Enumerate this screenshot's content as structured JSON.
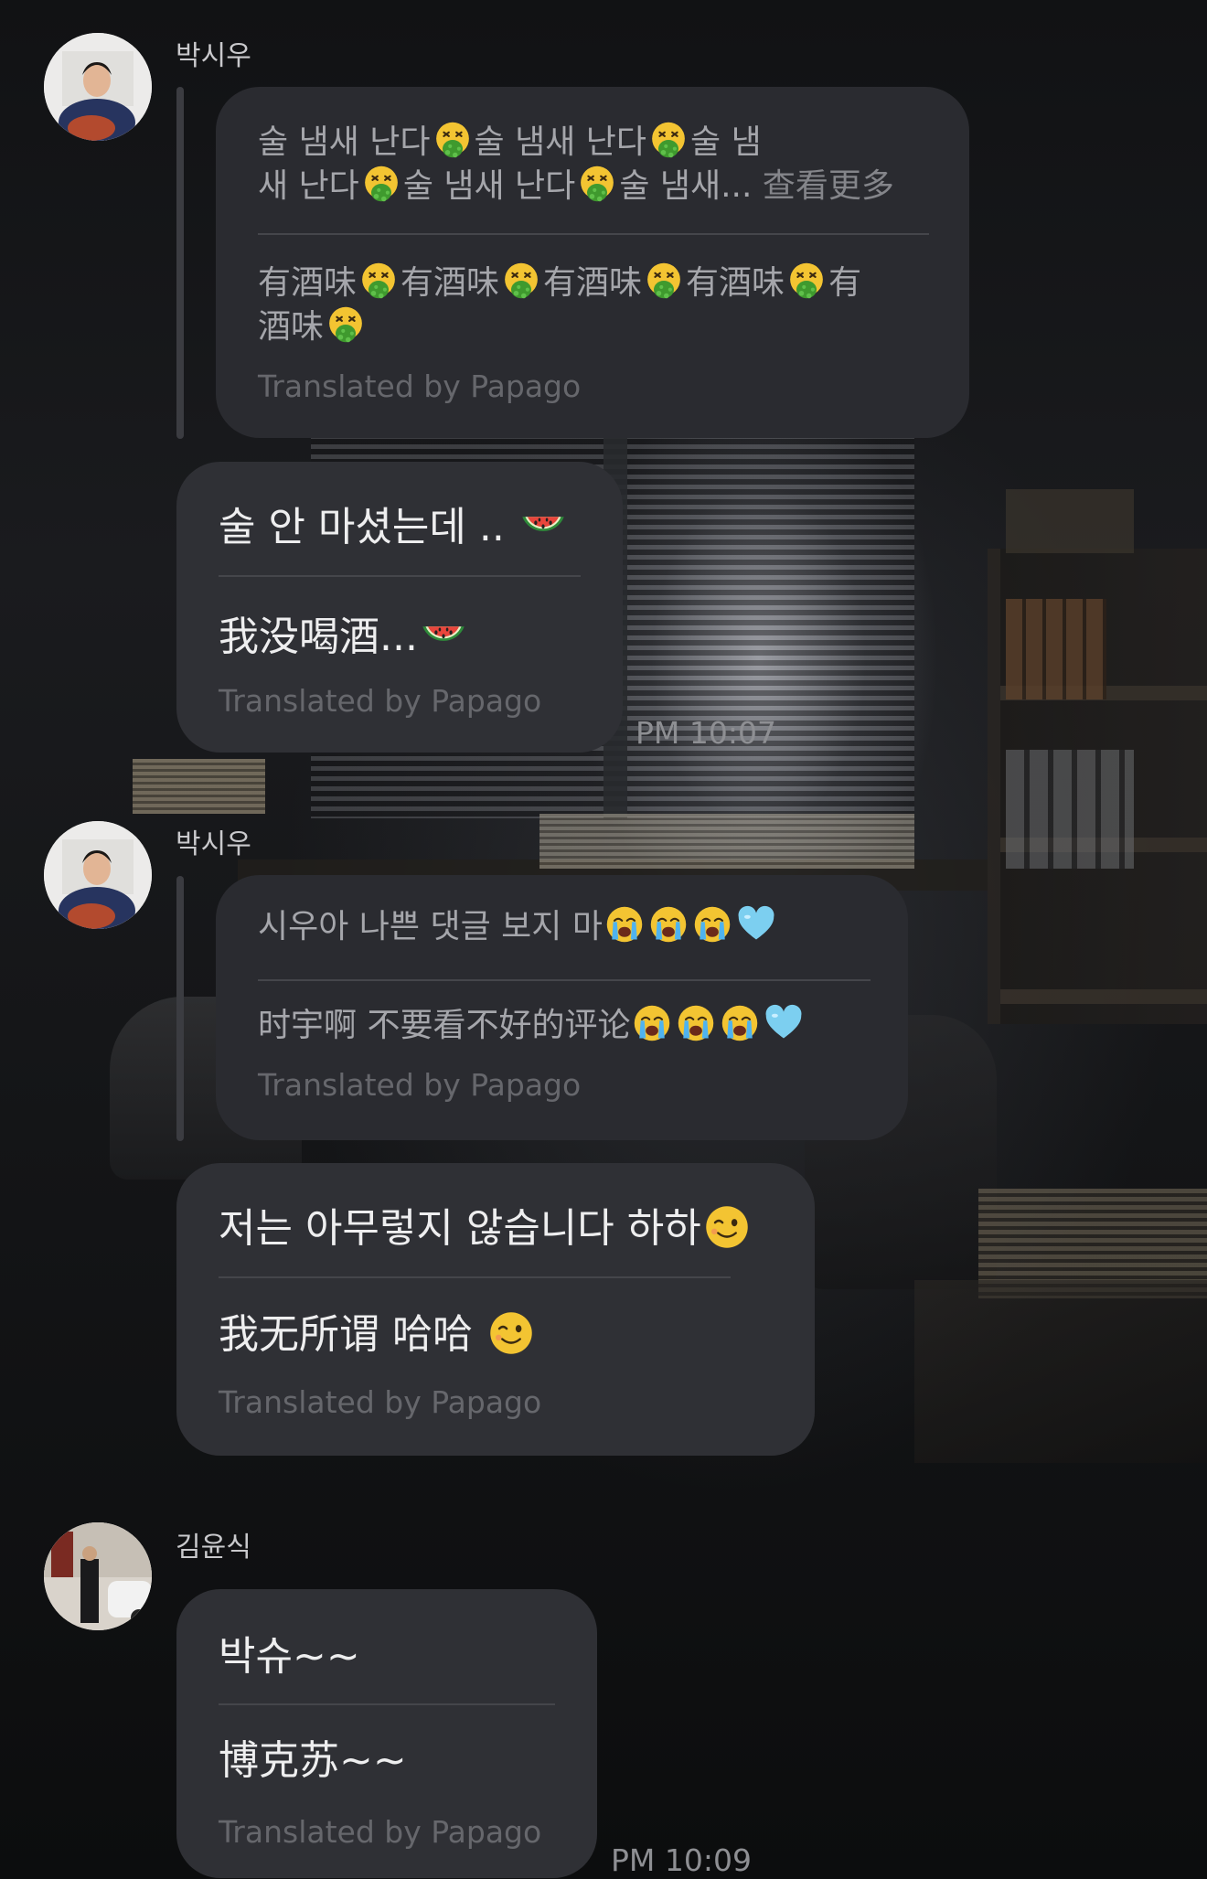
{
  "messages": [
    {
      "sender": "박시우",
      "quoted": {
        "original_line1": "술 냄새 난다",
        "original_line1b": "술 냄새 난다",
        "original_line1c": "술 냄",
        "original_line2": "새 난다",
        "original_line2b": "술 냄새 난다",
        "original_line2c": "술 냄새...",
        "see_more": "查看更多",
        "translated_word": "有酒味",
        "translated_line2": "酒味",
        "translated_tail": "有",
        "papago": "Translated by Papago"
      },
      "reply": {
        "original": "술 안 마셨는데 ..",
        "translated": "我没喝酒...",
        "papago": "Translated by Papago"
      },
      "time": "PM 10:07"
    },
    {
      "sender": "박시우",
      "quoted": {
        "original": "시우아 나쁜 댓글 보지 마",
        "translated": "时宇啊 不要看不好的评论",
        "papago": "Translated by Papago"
      },
      "reply": {
        "original": "저는 아무렇지 않습니다 하하",
        "translated": "我无所谓 哈哈",
        "papago": "Translated by Papago"
      }
    },
    {
      "sender": "김윤식",
      "reply": {
        "original": "박슈~~",
        "translated": "博克苏~~",
        "papago": "Translated by Papago"
      },
      "time": "PM 10:09"
    }
  ],
  "emoji_names": {
    "vomit": "face-vomiting-emoji",
    "watermelon": "watermelon-emoji",
    "crying": "loudly-crying-face-emoji",
    "blue_heart": "light-blue-heart-emoji",
    "wink": "winking-face-emoji"
  },
  "colors": {
    "bubble": "#2f3035",
    "bubble_text": "#eeeeef",
    "quoted_text": "#a5a6ab",
    "papago_text": "#66676c",
    "name_text": "#c9c9cc"
  }
}
